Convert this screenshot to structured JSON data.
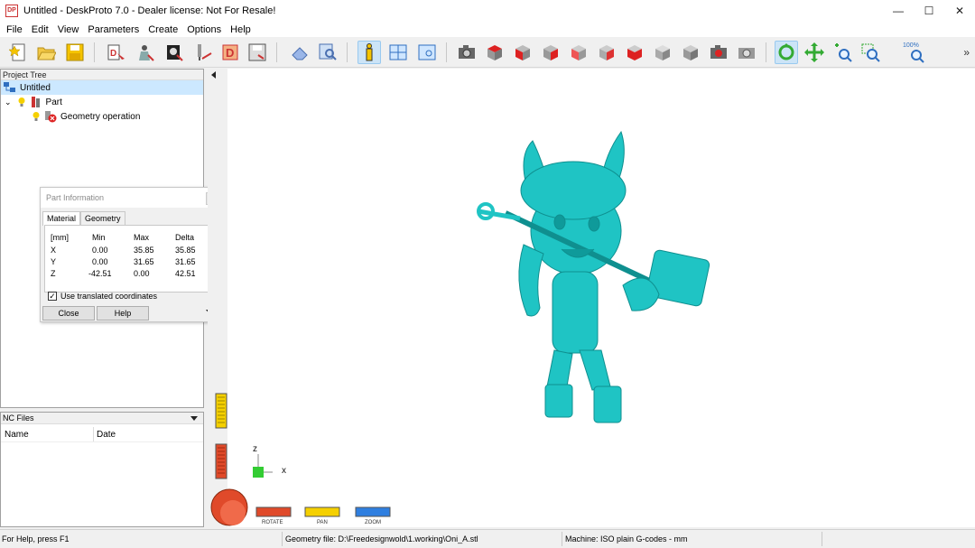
{
  "window": {
    "title": "Untitled - DeskProto 7.0 - Dealer license: Not For Resale!",
    "logo_text": "DP",
    "minimize": "—",
    "maximize": "☐",
    "close": "✕"
  },
  "menu": [
    "File",
    "Edit",
    "View",
    "Parameters",
    "Create",
    "Options",
    "Help"
  ],
  "toolbar": {
    "more": "»",
    "zoom_percent_label": "100%"
  },
  "project_tree": {
    "caption": "Project Tree",
    "items": [
      {
        "label": "Untitled"
      },
      {
        "label": "Part"
      },
      {
        "label": "Geometry operation"
      }
    ]
  },
  "part_info": {
    "title": "Part Information",
    "tabs": [
      "Material",
      "Geometry"
    ],
    "headers": [
      "[mm]",
      "Min",
      "Max",
      "Delta"
    ],
    "rows": [
      [
        "X",
        "0.00",
        "35.85",
        "35.85"
      ],
      [
        "Y",
        "0.00",
        "31.65",
        "31.65"
      ],
      [
        "Z",
        "-42.51",
        "0.00",
        "42.51"
      ]
    ],
    "checkbox_label": "Use translated coordinates",
    "checkbox_checked": true,
    "close_label": "Close",
    "help_label": "Help"
  },
  "nc_files": {
    "caption": "NC Files",
    "columns": [
      "Name",
      "Date"
    ]
  },
  "viewport": {
    "axis_z": "z",
    "axis_x": "x",
    "nav": [
      "ROTATE",
      "PAN",
      "ZOOM"
    ],
    "model_color": "#1fc4c4"
  },
  "status": {
    "help": "For Help, press F1",
    "geometry_file": "Geometry file: D:\\Freedesignwold\\1.working\\Oni_A.stl",
    "machine": "Machine: ISO plain G-codes - mm"
  }
}
